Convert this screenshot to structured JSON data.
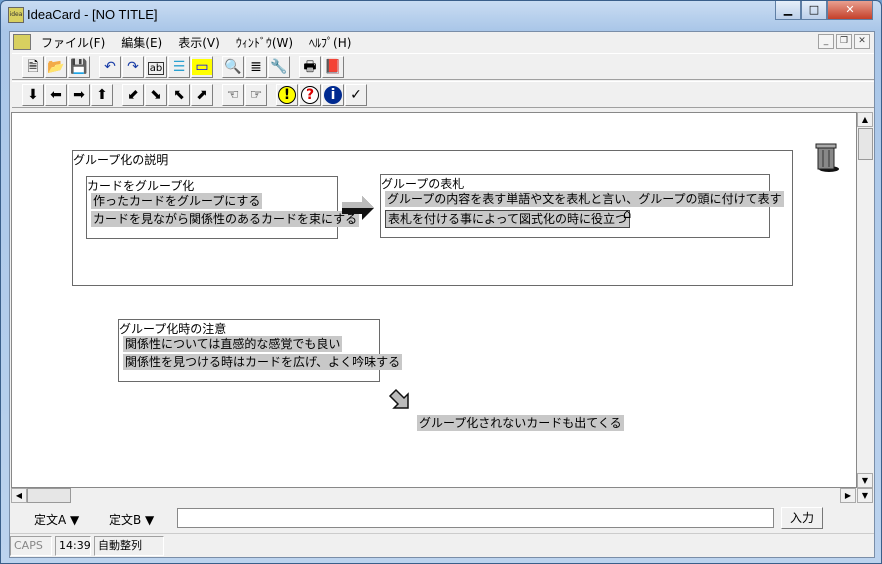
{
  "window": {
    "title": "IdeaCard - [NO TITLE]",
    "icon_text": "idea"
  },
  "menu": [
    "ファイル(F)",
    "編集(E)",
    "表示(V)",
    "ｳｨﾝﾄﾞｳ(W)",
    "ﾍﾙﾌﾟ(H)"
  ],
  "toolbar1": [
    {
      "name": "new-icon",
      "glyph": "🗎"
    },
    {
      "name": "open-icon",
      "glyph": "📂"
    },
    {
      "name": "save-icon",
      "glyph": "💾"
    },
    {
      "name": "undo-icon",
      "glyph": "↶"
    },
    {
      "name": "redo-icon",
      "glyph": "↷"
    },
    {
      "name": "text-field-icon",
      "glyph": "ab"
    },
    {
      "name": "list-icon",
      "glyph": "☰"
    },
    {
      "name": "note-icon",
      "glyph": "▭"
    },
    {
      "name": "search-icon",
      "glyph": "🔍"
    },
    {
      "name": "outline-icon",
      "glyph": "≣"
    },
    {
      "name": "wrench-icon",
      "glyph": "🔧"
    },
    {
      "name": "print-icon",
      "glyph": "🖶"
    },
    {
      "name": "book-icon",
      "glyph": "📕"
    }
  ],
  "toolbar2": [
    {
      "name": "arrow-down-icon",
      "glyph": "⬇"
    },
    {
      "name": "arrow-left-icon",
      "glyph": "⬅"
    },
    {
      "name": "arrow-right-icon",
      "glyph": "➡"
    },
    {
      "name": "arrow-up-icon",
      "glyph": "⬆"
    },
    {
      "name": "arrow-down-left-icon",
      "glyph": "⬋"
    },
    {
      "name": "arrow-down-right-icon",
      "glyph": "⬊"
    },
    {
      "name": "arrow-up-left-icon",
      "glyph": "⬉"
    },
    {
      "name": "arrow-up-right-icon",
      "glyph": "⬈"
    },
    {
      "name": "hand-left-icon",
      "glyph": "☜"
    },
    {
      "name": "hand-right-icon",
      "glyph": "☞"
    },
    {
      "name": "exclamation-icon",
      "glyph": "!"
    },
    {
      "name": "question-icon",
      "glyph": "?"
    },
    {
      "name": "info-icon",
      "glyph": "i"
    },
    {
      "name": "check-icon",
      "glyph": "✓"
    }
  ],
  "cards": {
    "group1": {
      "title": "グループ化の説明"
    },
    "card1": {
      "title": "カードをグループ化",
      "lines": [
        "作ったカードをグループにする",
        "カードを見ながら関係性のあるカードを束にする"
      ]
    },
    "card2": {
      "title": "グループの表札",
      "lines": [
        "グループの内容を表す単語や文を表札と言い、グループの頭に付けて表す",
        "表札を付ける事によって図式化の時に役立つ"
      ]
    },
    "card3": {
      "title": "グループ化時の注意",
      "lines": [
        "関係性については直感的な感覚でも良い",
        "関係性を見つける時はカードを広げ、よく吟味する"
      ]
    },
    "loose": "グループ化されないカードも出てくる"
  },
  "bottom": {
    "phrase_a": "定文A ▼",
    "phrase_b": "定文B ▼",
    "input_value": "",
    "enter_label": "入力"
  },
  "status": {
    "caps": "CAPS",
    "time": "14:39",
    "mode": "自動整列"
  }
}
